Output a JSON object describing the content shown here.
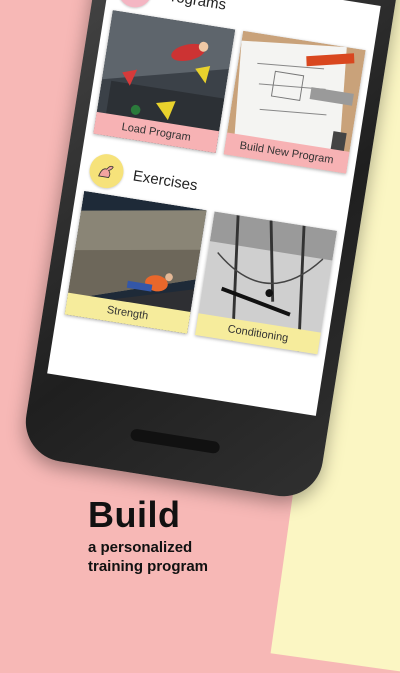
{
  "programs": {
    "title": "Programs",
    "icon": "books-glasses-icon",
    "tiles": [
      {
        "label": "Load Program"
      },
      {
        "label": "Build New Program"
      }
    ]
  },
  "exercises": {
    "title": "Exercises",
    "icon": "flexed-arm-icon",
    "tiles": [
      {
        "label": "Strength"
      },
      {
        "label": "Conditioning"
      }
    ]
  },
  "promo": {
    "headline": "Build",
    "subline_1": "a personalized",
    "subline_2": "training program"
  },
  "colors": {
    "background": "#f7b8b6",
    "accent_pink": "#f7b2b4",
    "accent_yellow": "#f6ec9c",
    "cream": "#fbf6c3"
  }
}
